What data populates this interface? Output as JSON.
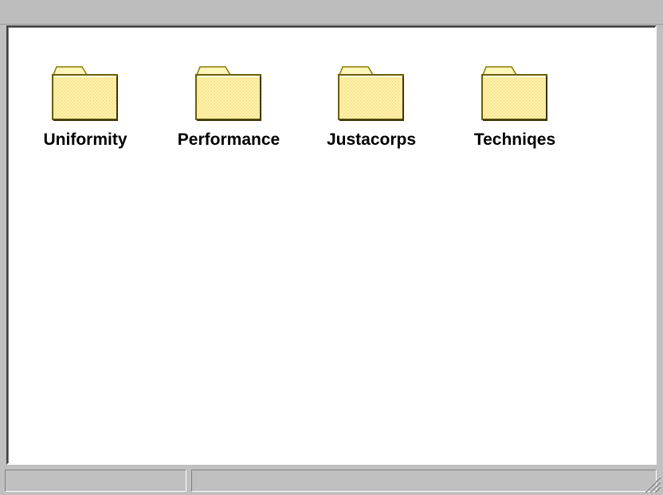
{
  "window": {
    "title": "",
    "colors": {
      "frame": "#c0c0c0",
      "content_bg": "#ffffff",
      "folder_fill": "#fdf2a0",
      "folder_outline": "#8a7a00"
    }
  },
  "folders": [
    {
      "label": "Uniformity",
      "icon": "folder-icon"
    },
    {
      "label": "Performance",
      "icon": "folder-icon"
    },
    {
      "label": "Justacorps",
      "icon": "folder-icon"
    },
    {
      "label": "Techniqes",
      "icon": "folder-icon"
    }
  ],
  "statusbar": {
    "left_text": "",
    "right_text": ""
  }
}
